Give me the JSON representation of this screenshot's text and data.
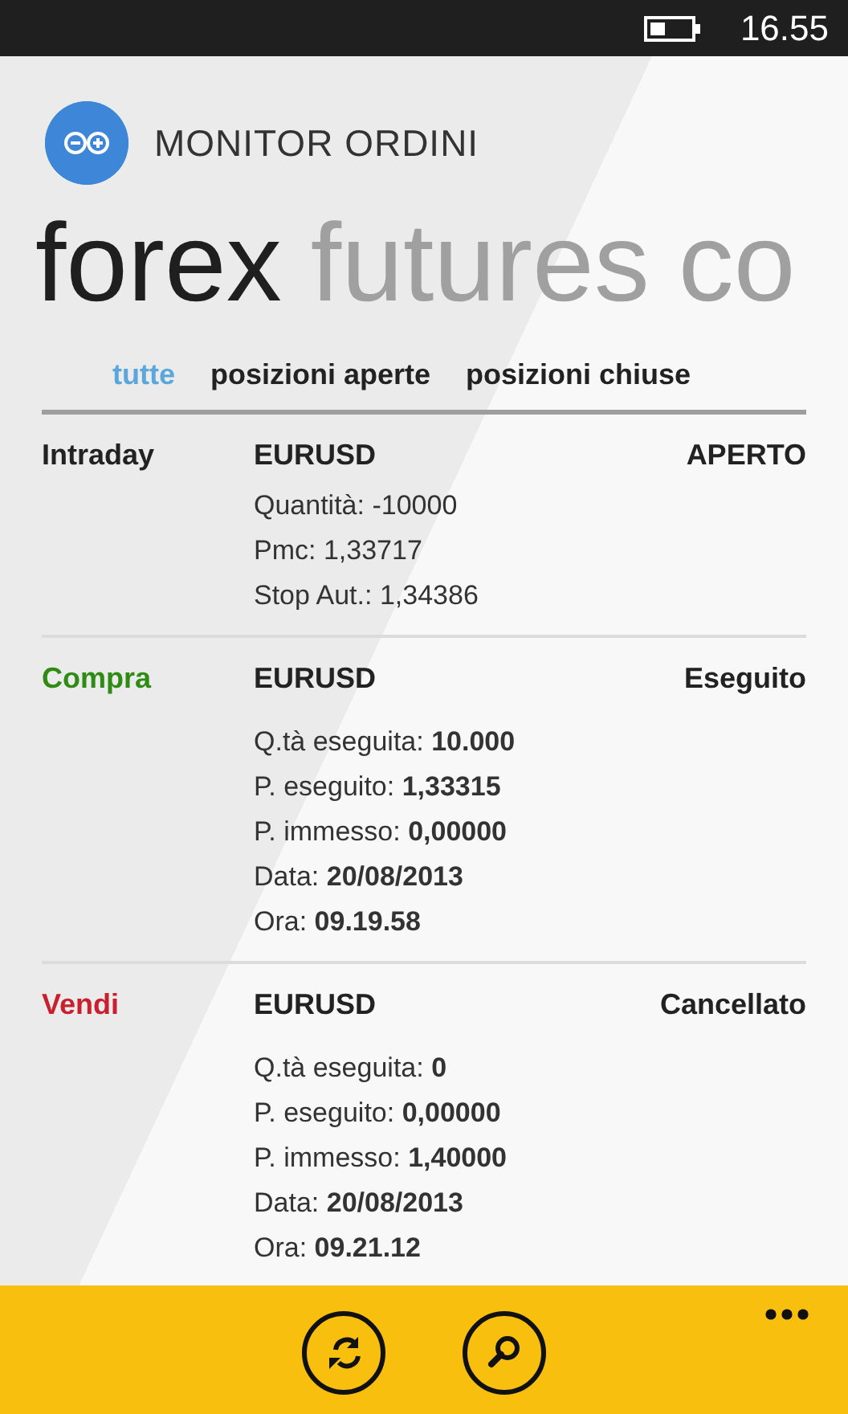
{
  "status_bar": {
    "time": "16.55"
  },
  "app": {
    "title": "MONITOR ORDINI"
  },
  "pivot": [
    {
      "label": "forex",
      "selected": true
    },
    {
      "label": "futures",
      "selected": false
    },
    {
      "label": "co",
      "selected": false
    }
  ],
  "filters": [
    {
      "label": "tutte",
      "selected": true
    },
    {
      "label": "posizioni aperte",
      "selected": false
    },
    {
      "label": "posizioni chiuse",
      "selected": false
    }
  ],
  "orders": [
    {
      "type": "Intraday",
      "color": "#222222",
      "symbol": "EURUSD",
      "status": "APERTO",
      "details": [
        "Quantità: -10000",
        "Pmc: 1,33717",
        "Stop Aut.: 1,34386"
      ]
    },
    {
      "type": "Compra",
      "color": "#2e8b14",
      "symbol": "EURUSD",
      "status": "Eseguito",
      "details": [
        "Q.tà eseguita: **10.000**",
        "P. eseguito: **1,33315**",
        "P. immesso: **0,00000**",
        "Data: **20/08/2013**",
        "Ora: **09.19.58**"
      ]
    },
    {
      "type": "Vendi",
      "color": "#c8202e",
      "symbol": "EURUSD",
      "status": "Cancellato",
      "details": [
        "Q.tà eseguita: **0**",
        "P. eseguito: **0,00000**",
        "P. immesso: **1,40000**",
        "Data: **20/08/2013**",
        "Ora: **09.21.12**"
      ]
    }
  ],
  "app_bar": {
    "buttons": [
      {
        "kind": "refresh"
      },
      {
        "kind": "search"
      }
    ]
  }
}
